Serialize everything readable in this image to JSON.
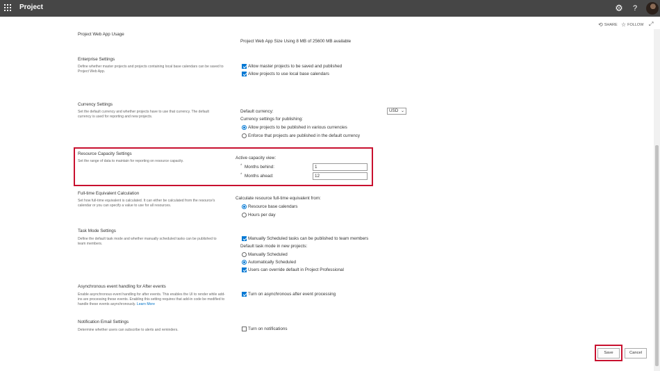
{
  "header": {
    "app_title": "Project",
    "share_label": "SHARE",
    "follow_label": "FOLLOW"
  },
  "icons": {
    "waffle": "app-launcher-icon",
    "settings": "gear-icon",
    "help": "question-mark-icon",
    "share": "share-icon",
    "follow": "star-icon",
    "focus": "expand-icon"
  },
  "colors": {
    "topbar": "#464646",
    "accent": "#0078d4",
    "highlight": "#c8102e"
  },
  "sections": {
    "pwa_usage": {
      "title": "Project Web App Usage",
      "value": "Project Web App Size Using 8 MB of 25600 MB available"
    },
    "enterprise": {
      "title": "Enterprise Settings",
      "desc": "Define whether master projects and projects containing local base calendars can be saved to Project Web App.",
      "opt1": "Allow master projects to be saved and published",
      "opt1_checked": true,
      "opt2": "Allow projects to use local base calendars",
      "opt2_checked": true
    },
    "currency": {
      "title": "Currency Settings",
      "desc": "Set the default currency and whether projects have to use that currency. The default currency is used for reporting and new projects.",
      "default_label": "Default currency:",
      "default_value": "USD",
      "publishing_label": "Currency settings for publishing:",
      "radio1": "Allow projects to be published in various currencies",
      "radio2": "Enforce that projects are published in the default currency",
      "selected": "radio1"
    },
    "resource_capacity": {
      "title": "Resource Capacity Settings",
      "desc": "Set the range of data to maintain for reporting on resource capacity.",
      "active_label": "Active capacity view:",
      "behind_label": "Months behind:",
      "behind_value": "1",
      "ahead_label": "Months ahead:",
      "ahead_value": "12",
      "required_mark": "*"
    },
    "fte": {
      "title": "Full-time Equivalent Calculation",
      "desc": "Set how full-time equivalent is calculated. It can either be calculated from the resource's calendar or you can specify a value to use for all resources.",
      "calc_label": "Calculate resource full-time equivalent from:",
      "radio1": "Resource base calendars",
      "radio2": "Hours per day",
      "selected": "radio1"
    },
    "task_mode": {
      "title": "Task Mode Settings",
      "desc": "Define the default task mode and whether manually scheduled tasks can be published to team members.",
      "opt1": "Manually Scheduled tasks can be published to team members",
      "opt1_checked": true,
      "default_label": "Default task mode in new projects:",
      "radio1": "Manually Scheduled",
      "radio2": "Automatically Scheduled",
      "selected": "radio2",
      "opt2": "Users can override default in Project Professional",
      "opt2_checked": true
    },
    "async": {
      "title": "Asynchronous event handling for After events",
      "desc": "Enable asynchronous event handling for after events. This enables the UI to render while add-ins are processing these events. Enabling this setting requires that add-in code be modified to handle these events asynchronously.",
      "learn_more": "Learn More",
      "opt1": "Turn on asynchronous after event processing",
      "opt1_checked": true
    },
    "notification": {
      "title": "Notification Email Settings",
      "desc": "Determine whether users can subscribe to alerts and reminders.",
      "opt1": "Turn on notifications",
      "opt1_checked": false
    }
  },
  "footer": {
    "save_label": "Save",
    "cancel_label": "Cancel"
  }
}
